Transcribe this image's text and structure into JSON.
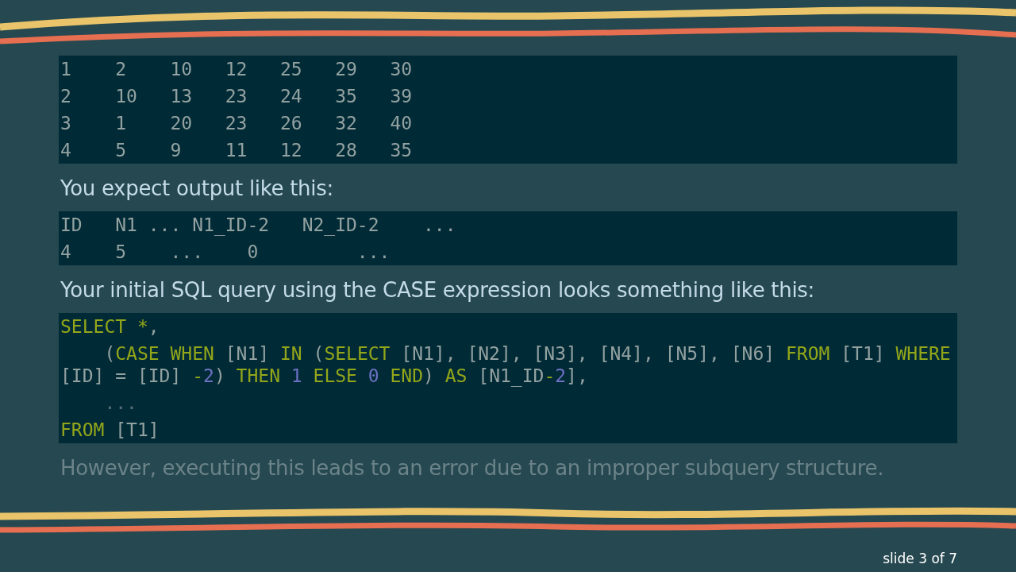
{
  "output_table": {
    "lines": [
      "1    2    10   12   25   29   30",
      "2    10   13   23   24   35   39",
      "3    1    20   23   26   32   40",
      "4    5    9    11   12   28   35"
    ]
  },
  "paragraphs": [
    {
      "text": "You expect output like this:",
      "dimmed": false
    },
    {
      "text": "Your initial SQL query using the CASE expression looks something like this:",
      "dimmed": false
    },
    {
      "text": "However, executing this leads to an error due to an improper subquery structure.",
      "dimmed": true
    }
  ],
  "expected_output": {
    "lines": [
      "ID   N1 ... N1_ID-2   N2_ID-2    ...",
      "4    5    ...    0         ..."
    ]
  },
  "sql_code": {
    "lines": [
      [
        {
          "text": "SELECT",
          "kind": "keyword"
        },
        {
          "text": " *",
          "kind": "keyword"
        },
        {
          "text": ",",
          "kind": "plain"
        }
      ],
      [
        {
          "text": "    (",
          "kind": "plain"
        },
        {
          "text": "CASE WHEN",
          "kind": "keyword"
        },
        {
          "text": " [N1] ",
          "kind": "plain"
        },
        {
          "text": "IN",
          "kind": "keyword"
        },
        {
          "text": " (",
          "kind": "plain"
        },
        {
          "text": "SELECT",
          "kind": "keyword"
        },
        {
          "text": " [N1], [N2], [N3], [N4], [N5], [N6] ",
          "kind": "plain"
        },
        {
          "text": "FROM",
          "kind": "keyword"
        },
        {
          "text": " [T1] ",
          "kind": "plain"
        },
        {
          "text": "WHERE",
          "kind": "keyword"
        },
        {
          "text": " [ID] = [ID] ",
          "kind": "plain"
        },
        {
          "text": "-",
          "kind": "keyword"
        },
        {
          "text": "2",
          "kind": "number"
        },
        {
          "text": ") ",
          "kind": "plain"
        },
        {
          "text": "THEN",
          "kind": "keyword"
        },
        {
          "text": " 1",
          "kind": "number"
        },
        {
          "text": " ELSE",
          "kind": "keyword"
        },
        {
          "text": " 0",
          "kind": "number"
        },
        {
          "text": " END",
          "kind": "keyword"
        },
        {
          "text": ") ",
          "kind": "plain"
        },
        {
          "text": "AS",
          "kind": "keyword"
        },
        {
          "text": " [N1_ID",
          "kind": "plain"
        },
        {
          "text": "-",
          "kind": "keyword"
        },
        {
          "text": "2",
          "kind": "number"
        },
        {
          "text": "],",
          "kind": "plain"
        }
      ],
      [
        {
          "text": "    ...",
          "kind": "comment"
        }
      ],
      [
        {
          "text": "FROM",
          "kind": "keyword"
        },
        {
          "text": " [T1]",
          "kind": "plain"
        }
      ]
    ]
  },
  "slide_counter": "slide 3 of 7"
}
